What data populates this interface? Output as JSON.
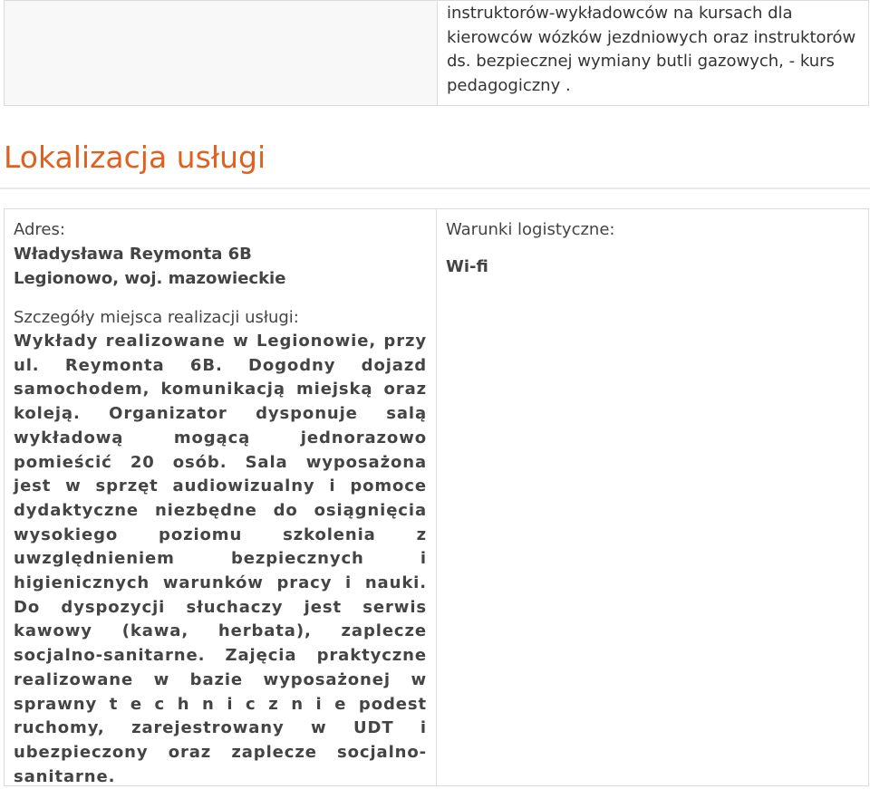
{
  "top_row": {
    "right_text": "instruktorów-wykładowców na kursach dla kierowców wózków jezdniowych oraz instruktorów ds. bezpiecznej wymiany butli gazowych, - kurs pedagogiczny ."
  },
  "section": {
    "title": "Lokalizacja usługi"
  },
  "address": {
    "label": "Adres:",
    "street": "Władysława Reymonta 6B",
    "city": "Legionowo, woj. mazowieckie"
  },
  "details": {
    "label": "Szczegóły miejsca realizacji usługi:",
    "text": "Wykłady realizowane w Legionowie, przy ul. Reymonta 6B. Dogodny dojazd samochodem, komunikacją miejską oraz koleją. Organizator dysponuje salą wykładową mogącą jednorazowo pomieścić 20 osób. Sala wyposażona jest w sprzęt audiowizualny i pomoce dydaktyczne niezbędne do osiągnięcia wysokiego poziomu szkolenia z uwzględnieniem bezpiecznych i higienicznych warunków pracy i nauki. Do dyspozycji słuchaczy jest serwis kawowy (kawa, herbata), zaplecze socjalno-sanitarne. Zajęcia praktyczne realizowane w bazie wyposażonej w sprawny t e c h n i c z n i e podest ruchomy, zarejestrowany w UDT i ubezpieczony oraz zaplecze socjalno-sanitarne."
  },
  "logistics": {
    "label": "Warunki logistyczne:",
    "value": "Wi-fi"
  },
  "colors": {
    "section_title": "#e06020",
    "border": "#dcdcdc",
    "text": "#444444"
  }
}
